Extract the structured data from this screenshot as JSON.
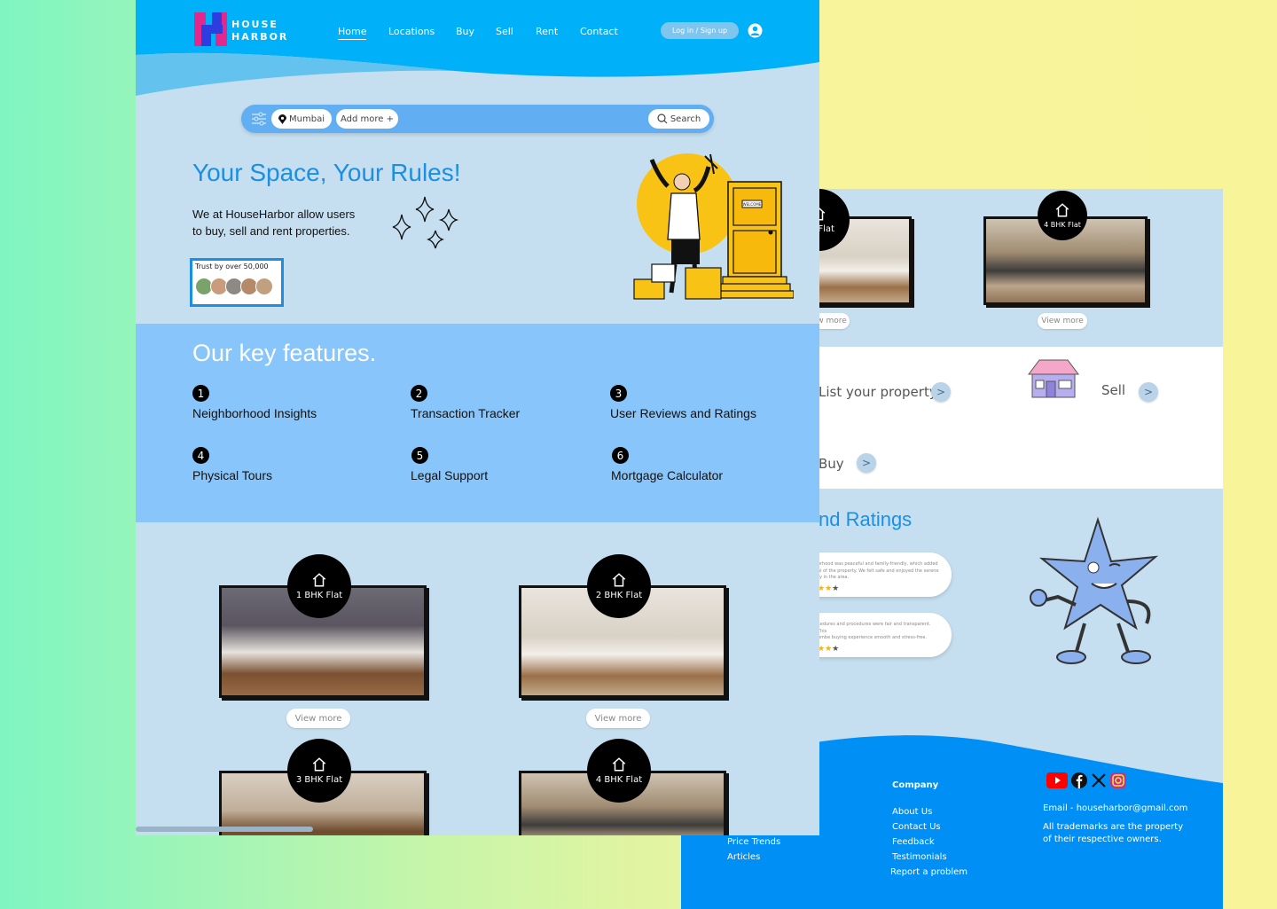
{
  "brand": {
    "line1": "HOUSE",
    "line2": "HARBOR"
  },
  "nav": {
    "items": [
      "Home",
      "Locations",
      "Buy",
      "Sell",
      "Rent",
      "Contact"
    ],
    "active": "Home",
    "login_label": "Log in / Sign up"
  },
  "search": {
    "location_chip": "Mumbai",
    "add_more": "Add more +",
    "button": "Search"
  },
  "hero": {
    "title": "Your Space, Your Rules!",
    "subtitle_line1": "We at HouseHarbor allow users",
    "subtitle_line2": "to buy, sell and rent properties.",
    "trust_label": "Trust by over 50,000",
    "door_sign": "WELCOME"
  },
  "features": {
    "title": "Our key features.",
    "items": [
      {
        "num": "1",
        "label": "Neighborhood Insights"
      },
      {
        "num": "2",
        "label": "Transaction Tracker"
      },
      {
        "num": "3",
        "label": "User Reviews and Ratings"
      },
      {
        "num": "4",
        "label": "Physical Tours"
      },
      {
        "num": "5",
        "label": "Legal Support"
      },
      {
        "num": "6",
        "label": "Mortgage Calculator"
      }
    ]
  },
  "listings": [
    {
      "label": "1 BHK Flat",
      "cta": "View more"
    },
    {
      "label": "2 BHK Flat",
      "cta": "View more"
    },
    {
      "label": "3 BHK Flat",
      "cta": "View more"
    },
    {
      "label": "4 BHK Flat",
      "cta": "View more"
    }
  ],
  "back_page": {
    "listings": [
      {
        "label": "HK Flat",
        "cta": "w more"
      },
      {
        "label": "4 BHK Flat",
        "cta": "View more"
      }
    ],
    "actions": {
      "list": "List your property",
      "sell": "Sell",
      "buy": "Buy"
    },
    "reviews_title": "nd Ratings",
    "reviews": [
      {
        "text_line1": "orhood was peaceful and family-friendly, which added",
        "text_line2": "al of the property. We felt safe and enjoyed the serene",
        "text_line3": "ty in the area."
      },
      {
        "text_line1": "cedures and procedures were fair and transparent. This",
        "text_line2": "ombe buying experience smooth and stress-free."
      }
    ],
    "footer": {
      "col1": [
        "Price Trends",
        "Articles"
      ],
      "company_heading": "Company",
      "company_links": [
        "About Us",
        "Contact Us",
        "Feedback",
        "Testimonials",
        "Report a problem"
      ],
      "email": "Email - househarbor@gmail.com",
      "trademark_line1": "All trademarks are the property",
      "trademark_line2": "of their respective owners.",
      "social_icons": [
        "youtube-icon",
        "facebook-icon",
        "x-icon",
        "instagram-icon"
      ]
    }
  },
  "colors": {
    "primary": "#00b0f8",
    "accent": "#1b8fe4",
    "page_bg": "#c6dff0",
    "features_bg": "#88c5fa",
    "footer_bg": "#008ff5"
  }
}
